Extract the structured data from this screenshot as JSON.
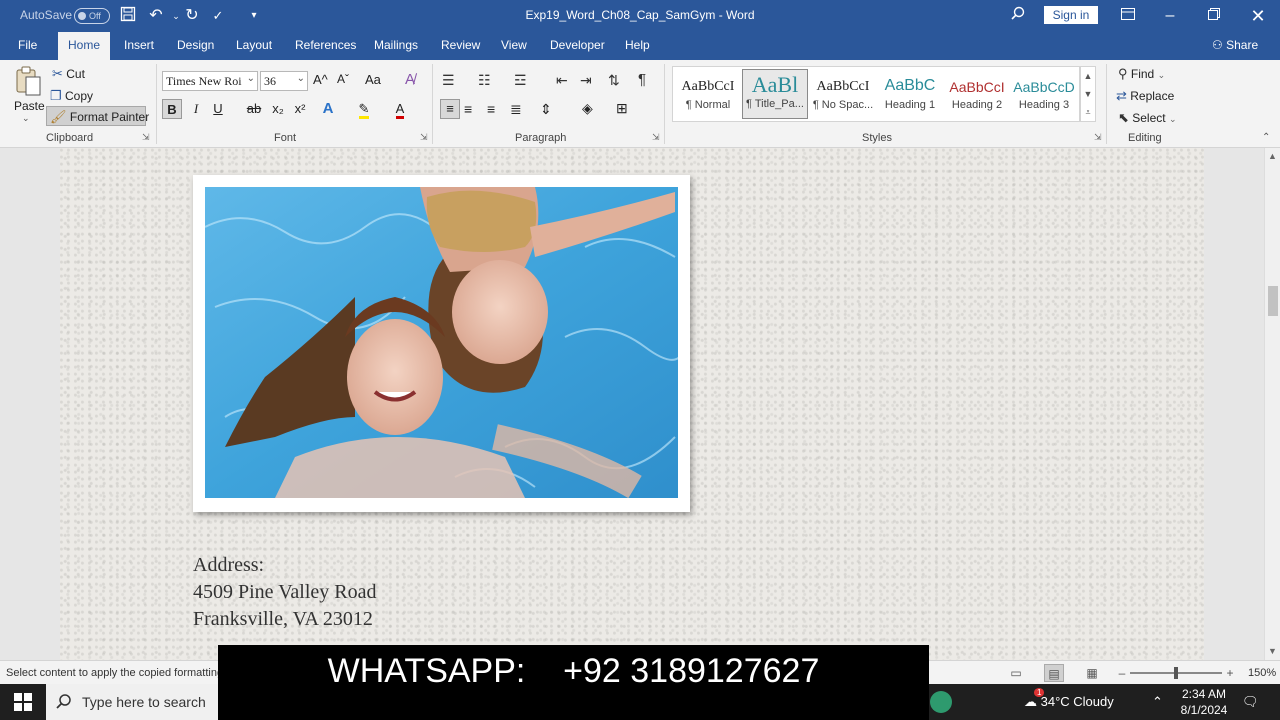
{
  "titlebar": {
    "autosave_label": "AutoSave",
    "autosave_state": "Off",
    "document_title": "Exp19_Word_Ch08_Cap_SamGym  -  Word",
    "sign_in": "Sign in"
  },
  "menu": {
    "tabs": [
      "File",
      "Home",
      "Insert",
      "Design",
      "Layout",
      "References",
      "Mailings",
      "Review",
      "View",
      "Developer",
      "Help"
    ],
    "active_tab": "Home",
    "share": "Share"
  },
  "ribbon": {
    "clipboard": {
      "paste": "Paste",
      "cut": "Cut",
      "copy": "Copy",
      "format_painter": "Format Painter",
      "label": "Clipboard"
    },
    "font": {
      "font_name": "Times New Roi",
      "font_size": "36",
      "bold": "B",
      "italic": "I",
      "underline": "U",
      "strike": "ab",
      "sub": "x₂",
      "sup": "x²",
      "change_case": "Aa",
      "grow": "A^",
      "shrink": "Aˇ",
      "label": "Font"
    },
    "paragraph": {
      "label": "Paragraph"
    },
    "styles": {
      "label": "Styles",
      "items": [
        {
          "sample": "AaBbCcI",
          "name": "¶ Normal",
          "color": "#222222"
        },
        {
          "sample": "AaBl",
          "name": "¶ Title_Pa...",
          "color": "#2a8c99"
        },
        {
          "sample": "AaBbCcI",
          "name": "¶ No Spac...",
          "color": "#222222"
        },
        {
          "sample": "AaBbC",
          "name": "Heading 1",
          "color": "#2a8c99"
        },
        {
          "sample": "AaBbCcI",
          "name": "Heading 2",
          "color": "#b03030"
        },
        {
          "sample": "AaBbCcD",
          "name": "Heading 3",
          "color": "#2a8c99"
        }
      ]
    },
    "editing": {
      "find": "Find",
      "replace": "Replace",
      "select": "Select",
      "label": "Editing"
    }
  },
  "document": {
    "address_heading": "Address:",
    "address_line1": "4509 Pine Valley Road",
    "address_line2": "Franksville, VA 23012"
  },
  "statusbar": {
    "message": "Select content to apply the copied formatting",
    "zoom": "150%",
    "zoom_level": 0.5
  },
  "overlay": {
    "text": "WHATSAPP:    +92 3189127627"
  },
  "taskbar": {
    "search_placeholder": "Type here to search",
    "weather": "34°C  Cloudy",
    "time": "2:34 AM",
    "date": "8/1/2024",
    "weather_badge": "1"
  },
  "colors": {
    "word_blue": "#2b579a",
    "ribbon_bg": "#f3f3f3"
  }
}
